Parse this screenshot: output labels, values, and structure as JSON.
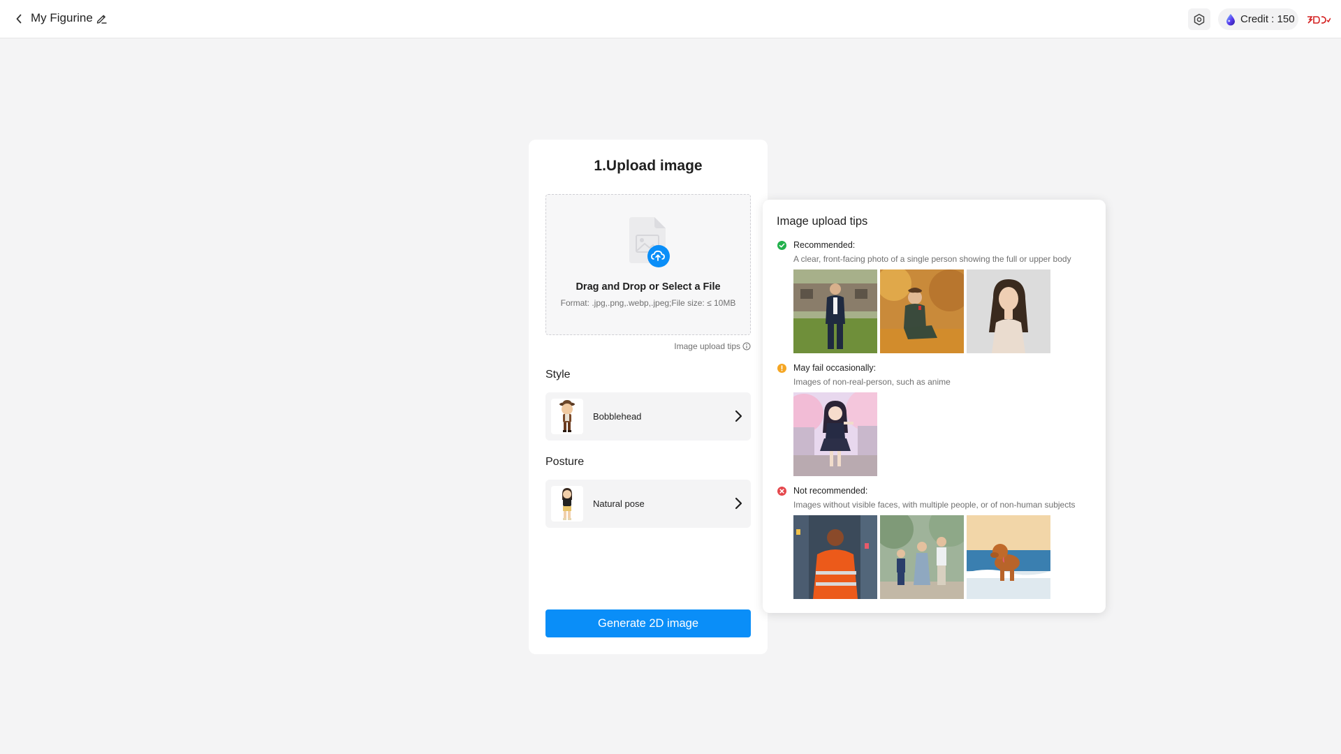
{
  "header": {
    "title": "My Figurine",
    "credit_label": "Credit : 150",
    "icons": {
      "back": "chevron-left-icon",
      "edit": "pencil-icon",
      "settings": "settings-icon",
      "credit": "credit-gem-icon",
      "brand": "brand-logo"
    }
  },
  "upload": {
    "title": "1.Upload image",
    "drop_title": "Drag and Drop or Select a File",
    "drop_format": "Format: .jpg,.png,.webp,.jpeg;File size: ≤ 10MB",
    "tips_link": "Image upload tips"
  },
  "style": {
    "label": "Style",
    "value": "Bobblehead"
  },
  "posture": {
    "label": "Posture",
    "value": "Natural pose"
  },
  "generate_label": "Generate 2D image",
  "tips": {
    "title": "Image upload tips",
    "recommended": {
      "heading": "Recommended:",
      "desc": "A clear, front-facing photo of a single person showing the full or upper body",
      "color": "#22b14c"
    },
    "may_fail": {
      "heading": "May fail occasionally:",
      "desc": "Images of non-real-person, such as anime",
      "color": "#f5a623"
    },
    "not_recommended": {
      "heading": "Not recommended:",
      "desc": "Images without visible faces, with multiple people, or of non-human subjects",
      "color": "#e5484d"
    }
  },
  "colors": {
    "accent": "#0a8ef8",
    "background": "#f4f4f5"
  }
}
